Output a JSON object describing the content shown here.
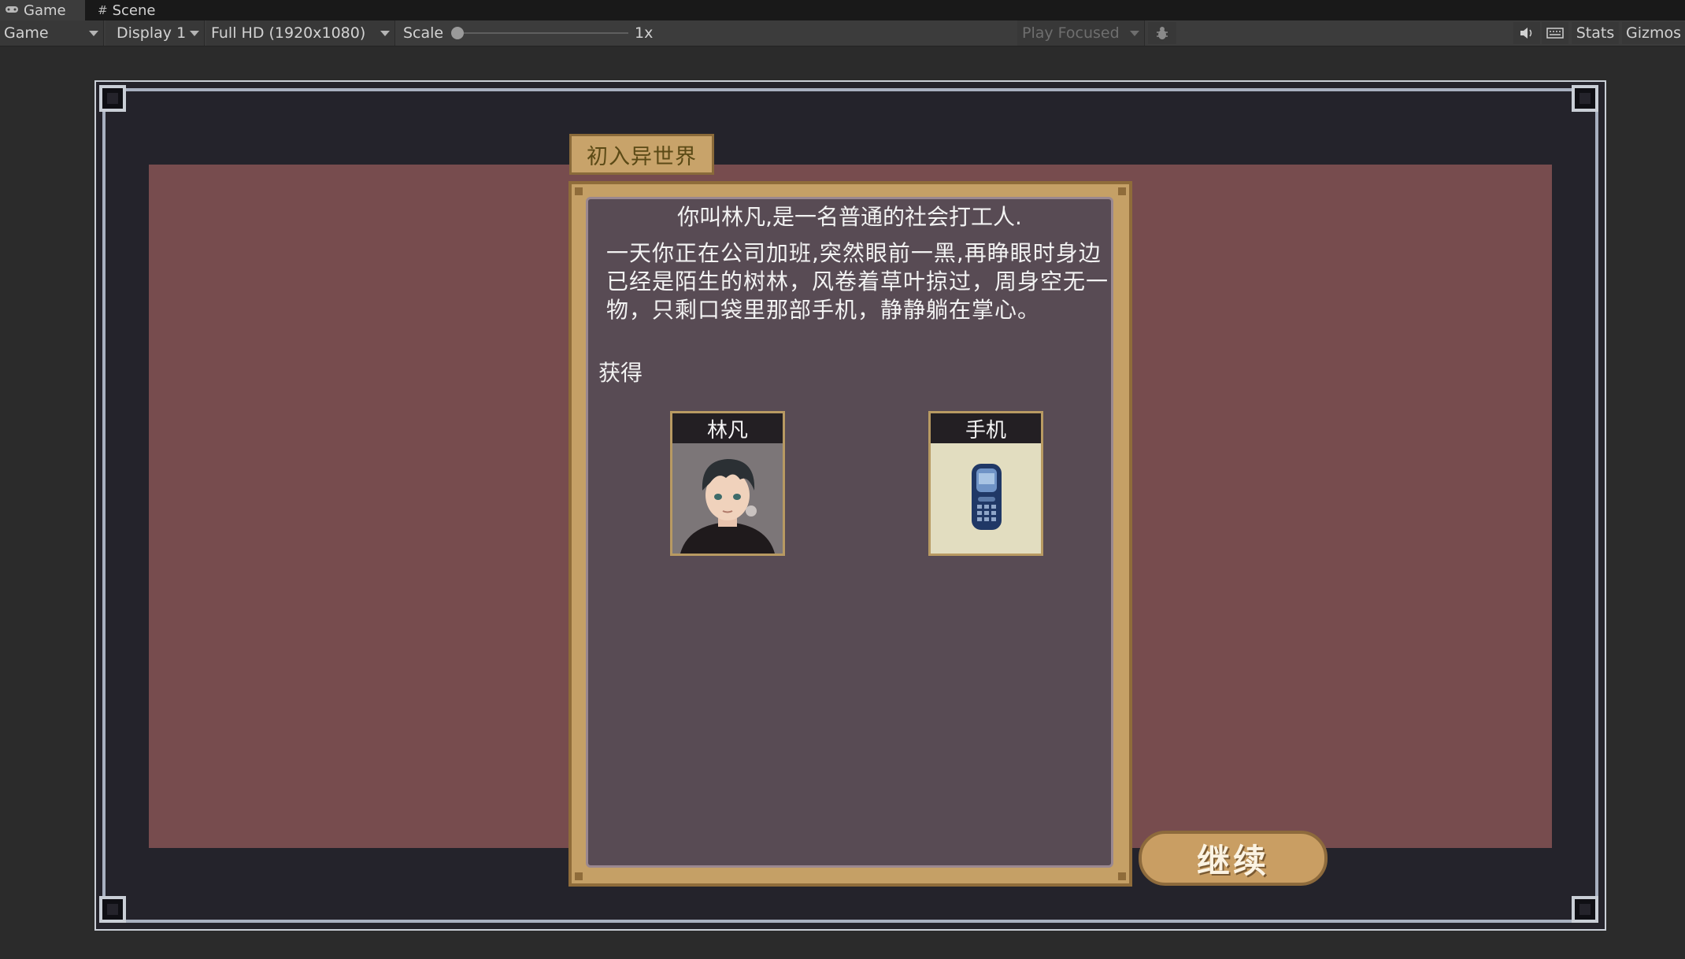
{
  "tabs": [
    {
      "label": "Game",
      "icon": "gamepad-icon"
    },
    {
      "label": "Scene",
      "icon": "grid-icon"
    }
  ],
  "toolbar": {
    "view_select": "Game",
    "display_select": "Display 1",
    "resolution_select": "Full HD (1920x1080)",
    "scale_label": "Scale",
    "scale_value": "1x",
    "play_focus_select": "Play Focused",
    "stats_label": "Stats",
    "gizmos_label": "Gizmos"
  },
  "game": {
    "chapter_title": "初入异世界",
    "intro_line": "你叫林凡,是一名普通的社会打工人.",
    "story_text": "一天你正在公司加班,突然眼前一黑,再睁眼时身边已经是陌生的树林，风卷着草叶掠过，周身空无一物，只剩口袋里那部手机，静静躺在掌心。",
    "obtain_label": "获得",
    "rewards": [
      {
        "name": "林凡",
        "icon": "character-portrait-icon"
      },
      {
        "name": "手机",
        "icon": "mobile-phone-icon"
      }
    ],
    "continue_label": "继续"
  },
  "colors": {
    "panel_bg": "#774c4e",
    "dialog_frame": "#c5a066",
    "dialog_inner": "#584b54",
    "button": "#c99e63"
  }
}
